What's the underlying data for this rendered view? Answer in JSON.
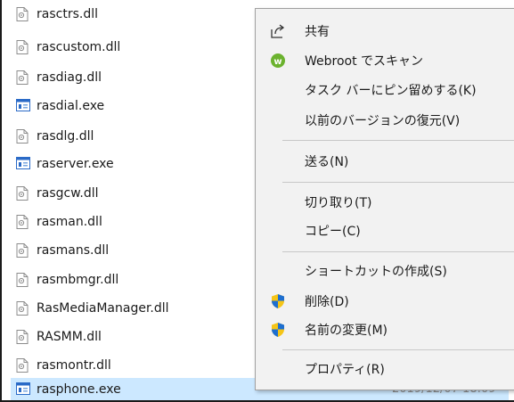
{
  "files": [
    {
      "name": "rasctrs.dll",
      "icon": "dll-file-icon"
    },
    {
      "name": "rascustom.dll",
      "icon": "dll-file-icon"
    },
    {
      "name": "rasdiag.dll",
      "icon": "dll-file-icon"
    },
    {
      "name": "rasdial.exe",
      "icon": "exe-file-icon"
    },
    {
      "name": "rasdlg.dll",
      "icon": "dll-file-icon"
    },
    {
      "name": "raserver.exe",
      "icon": "exe-file-icon"
    },
    {
      "name": "rasgcw.dll",
      "icon": "dll-file-icon"
    },
    {
      "name": "rasman.dll",
      "icon": "dll-file-icon"
    },
    {
      "name": "rasmans.dll",
      "icon": "dll-file-icon"
    },
    {
      "name": "rasmbmgr.dll",
      "icon": "dll-file-icon"
    },
    {
      "name": "RasMediaManager.dll",
      "icon": "dll-file-icon"
    },
    {
      "name": "RASMM.dll",
      "icon": "dll-file-icon"
    },
    {
      "name": "rasmontr.dll",
      "icon": "dll-file-icon"
    },
    {
      "name": "rasphone.exe",
      "icon": "exe-file-icon",
      "date": "2019/12/07 18:09"
    }
  ],
  "context_menu": {
    "items": [
      {
        "label": "共有",
        "icon": "share-icon"
      },
      {
        "label": "Webroot でスキャン",
        "icon": "webroot-icon"
      },
      {
        "label": "タスク バーにピン留めする(K)",
        "icon": ""
      },
      {
        "label": "以前のバージョンの復元(V)",
        "icon": ""
      },
      {
        "label": "送る(N)",
        "icon": ""
      },
      {
        "label": "切り取り(T)",
        "icon": ""
      },
      {
        "label": "コピー(C)",
        "icon": ""
      },
      {
        "label": "ショートカットの作成(S)",
        "icon": ""
      },
      {
        "label": "削除(D)",
        "icon": "uac-shield-icon"
      },
      {
        "label": "名前の変更(M)",
        "icon": "uac-shield-icon"
      },
      {
        "label": "プロパティ(R)",
        "icon": ""
      }
    ]
  },
  "colors": {
    "selection": "#cce8ff",
    "menu_background": "#f2f2f2",
    "webroot_green": "#6bb22e",
    "shield_blue": "#1e6fd0",
    "shield_yellow": "#f5c518"
  }
}
